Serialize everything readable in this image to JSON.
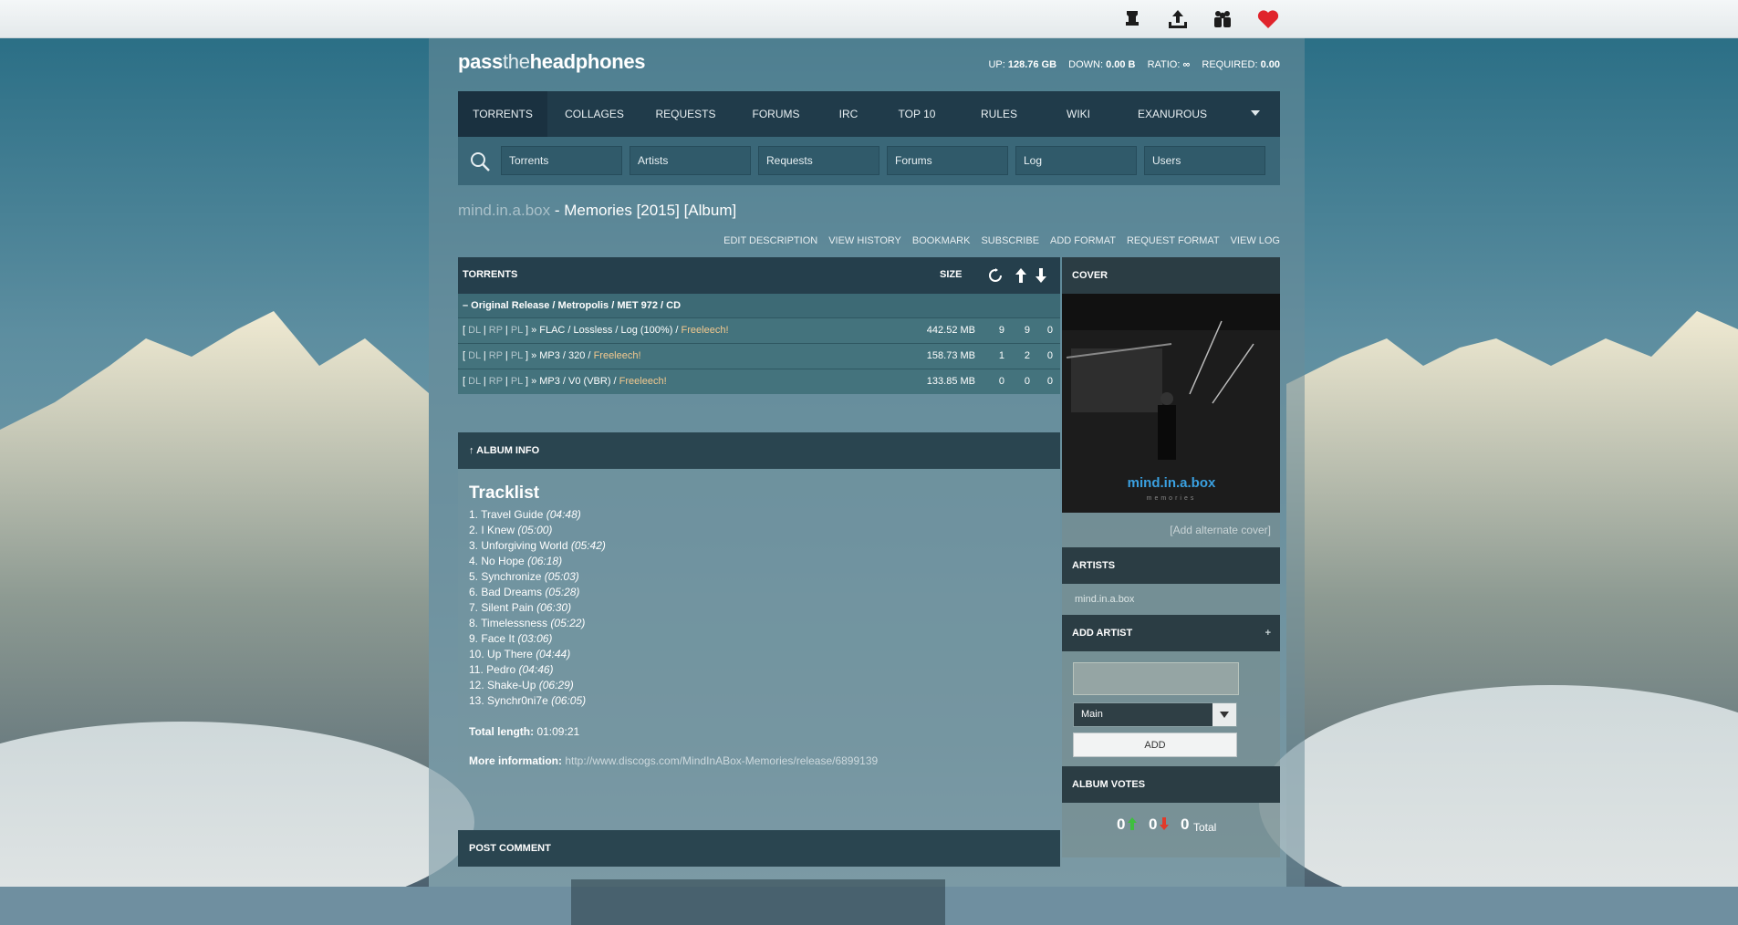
{
  "topbar": {
    "icons": [
      "rank-icon",
      "upload-icon",
      "friends-icon",
      "heart-icon"
    ]
  },
  "site": {
    "logo_bold1": "pass",
    "logo_thin": "the",
    "logo_bold2": "headphones"
  },
  "stats": {
    "up_label": "UP:",
    "up_value": "128.76 GB",
    "down_label": "DOWN:",
    "down_value": "0.00 B",
    "ratio_label": "RATIO:",
    "ratio_value": "∞",
    "required_label": "REQUIRED:",
    "required_value": "0.00"
  },
  "menu": [
    "TORRENTS",
    "COLLAGES",
    "REQUESTS",
    "FORUMS",
    "IRC",
    "TOP 10",
    "RULES",
    "WIKI",
    "EXANUROUS"
  ],
  "search": {
    "placeholders": [
      "Torrents",
      "Artists",
      "Requests",
      "Forums",
      "Log",
      "Users"
    ]
  },
  "title": {
    "artist": "mind.in.a.box",
    "rest": " - Memories [2015] [Album]"
  },
  "actions": [
    "EDIT DESCRIPTION",
    "VIEW HISTORY",
    "BOOKMARK",
    "SUBSCRIBE",
    "ADD FORMAT",
    "REQUEST FORMAT",
    "VIEW LOG"
  ],
  "torrents": {
    "header": "TORRENTS",
    "size_header": "SIZE",
    "group": "– Original Release / Metropolis / MET 972 / CD",
    "rows": [
      {
        "dl": "DL",
        "rp": "RP",
        "pl": "PL",
        "format": "» FLAC / Lossless / Log (100%) /",
        "free": "Freeleech!",
        "size": "442.52 MB",
        "snatched": "9",
        "seeders": "9",
        "leechers": "0"
      },
      {
        "dl": "DL",
        "rp": "RP",
        "pl": "PL",
        "format": "» MP3 / 320 /",
        "free": "Freeleech!",
        "size": "158.73 MB",
        "snatched": "1",
        "seeders": "2",
        "leechers": "0"
      },
      {
        "dl": "DL",
        "rp": "RP",
        "pl": "PL",
        "format": "» MP3 / V0 (VBR) /",
        "free": "Freeleech!",
        "size": "133.85 MB",
        "snatched": "0",
        "seeders": "0",
        "leechers": "0"
      }
    ]
  },
  "album_info": {
    "header": "↑ ALBUM INFO",
    "tracklist_title": "Tracklist",
    "tracks": [
      {
        "n": "1.",
        "name": "Travel Guide",
        "len": "(04:48)"
      },
      {
        "n": "2.",
        "name": "I Knew",
        "len": "(05:00)"
      },
      {
        "n": "3.",
        "name": "Unforgiving World",
        "len": "(05:42)"
      },
      {
        "n": "4.",
        "name": "No Hope",
        "len": "(06:18)"
      },
      {
        "n": "5.",
        "name": "Synchronize",
        "len": "(05:03)"
      },
      {
        "n": "6.",
        "name": "Bad Dreams",
        "len": "(05:28)"
      },
      {
        "n": "7.",
        "name": "Silent Pain",
        "len": "(06:30)"
      },
      {
        "n": "8.",
        "name": "Timelessness",
        "len": "(05:22)"
      },
      {
        "n": "9.",
        "name": "Face It",
        "len": "(03:06)"
      },
      {
        "n": "10.",
        "name": "Up There",
        "len": "(04:44)"
      },
      {
        "n": "11.",
        "name": "Pedro",
        "len": "(04:46)"
      },
      {
        "n": "12.",
        "name": "Shake-Up",
        "len": "(06:29)"
      },
      {
        "n": "13.",
        "name": "Synchr0ni7e",
        "len": "(06:05)"
      }
    ],
    "total_label": "Total length:",
    "total_value": "01:09:21",
    "more_label": "More information:",
    "more_url": "http://www.discogs.com/MindInABox-Memories/release/6899139"
  },
  "post_comment": "POST COMMENT",
  "sidebar": {
    "cover_header": "COVER",
    "cover_text": "mind.in.a.box",
    "cover_subtext": "memories",
    "add_cover": "[Add alternate cover]",
    "artists_header": "ARTISTS",
    "artist": "mind.in.a.box",
    "add_artist_header": "ADD ARTIST",
    "add_artist_plus": "+",
    "role": "Main",
    "add_button": "ADD",
    "votes_header": "ALBUM VOTES",
    "up_votes": "0",
    "down_votes": "0",
    "total_votes": "0",
    "total_label": "Total"
  },
  "colors": {
    "menu_bg": "#203b4a",
    "freeleech": "#f3c98f",
    "upvote": "#3fbf3f",
    "downvote": "#e03a2a",
    "heart": "#e0242c"
  }
}
